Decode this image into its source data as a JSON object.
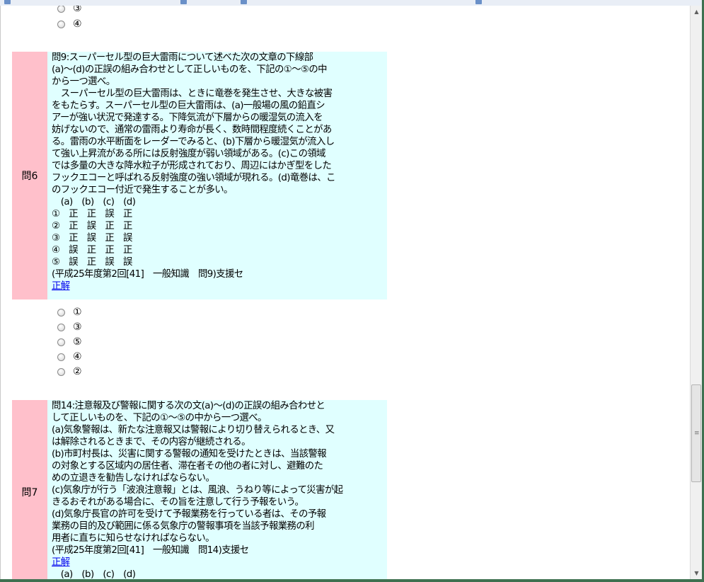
{
  "top_options": [
    "③",
    "④"
  ],
  "q6": {
    "number": "問6",
    "lines": [
      "問9:スーパーセル型の巨大雷雨について述べた次の文章の下線部",
      "(a)～(d)の正誤の組み合わせとして正しいものを、下記の①～⑤の中",
      "から一つ選べ。",
      "　スーパーセル型の巨大雷雨は、ときに竜巻を発生させ、大きな被害",
      "をもたらす。スーパーセル型の巨大雷雨は、(a)一般場の風の鉛直シ",
      "アーが強い状況で発達する。下降気流が下層からの暖湿気の流入を",
      "妨げないので、通常の雷雨より寿命が長く、数時間程度続くことがあ",
      "る。雷雨の水平断面をレーダーでみると、(b)下層から暖湿気が流入し",
      "て強い上昇流がある所には反射強度が弱い領域がある。(c)この領域",
      "では多量の大きな降水粒子が形成されており、周辺にはかぎ型をした",
      "フックエコーと呼ばれる反射強度の強い領域が現れる。(d)竜巻は、こ",
      "のフックエコー付近で発生することが多い。"
    ],
    "header_row": "　(a)　(b)　(c)　(d)",
    "choices": [
      "①　正　正　誤　正",
      "②　正　誤　正　正",
      "③　正　誤　正　誤",
      "④　誤　正　正　正",
      "⑤　誤　正　誤　誤"
    ],
    "source": "(平成25年度第2回[41]　一般知識　問9)支援セ",
    "answer_link": "正解",
    "options": [
      "①",
      "③",
      "⑤",
      "④",
      "②"
    ]
  },
  "q7": {
    "number": "問7",
    "lines": [
      "問14:注意報及び警報に関する次の文(a)～(d)の正誤の組み合わせと",
      "して正しいものを、下記の①～⑤の中から一つ選べ。",
      "(a)気象警報は、新たな注意報又は警報により切り替えられるとき、又",
      "は解除されるときまで、その内容が継続される。",
      "(b)市町村長は、災害に関する警報の通知を受けたときは、当該警報",
      "の対象とする区域内の居住者、滞在者その他の者に対し、避難のた",
      "めの立退きを勧告しなければならない。",
      "(c)気象庁が行う「波浪注意報」とは、風浪、うねり等によって災害が起",
      "きるおそれがある場合に、その旨を注意して行う予報をいう。",
      "(d)気象庁長官の許可を受けて予報業務を行っている者は、その予報",
      "業務の目的及び範囲に係る気象庁の警報事項を当該予報業務の利",
      "用者に直ちに知らせなければならない。"
    ],
    "source": "(平成25年度第2回[41]　一般知識　問14)支援セ",
    "answer_link": "正解",
    "header_row": "　(a)　(b)　(c)　(d)"
  }
}
